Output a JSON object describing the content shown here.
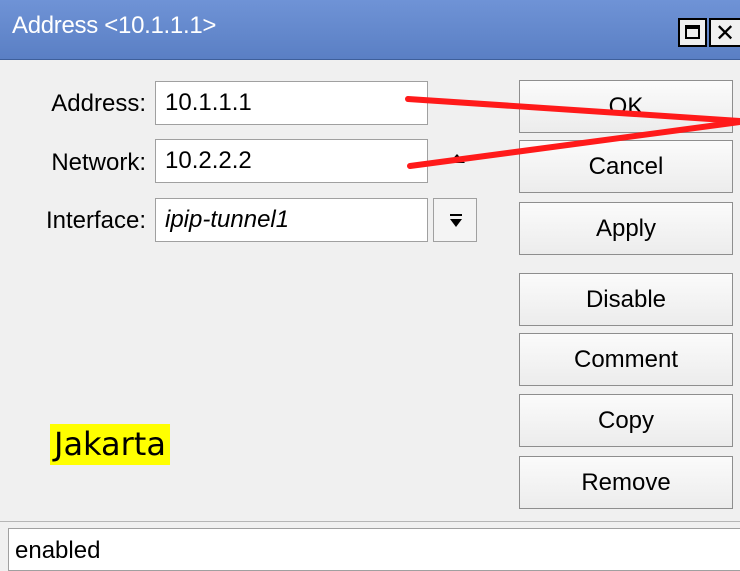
{
  "window": {
    "title": "Address <10.1.1.1>",
    "controls": [
      "maximize-icon",
      "close-icon"
    ]
  },
  "form": {
    "address": {
      "label": "Address:",
      "value": "10.1.1.1"
    },
    "network": {
      "label": "Network:",
      "value": "10.2.2.2"
    },
    "interface": {
      "label": "Interface:",
      "value": "ipip-tunnel1"
    }
  },
  "buttons": {
    "ok": "OK",
    "cancel": "Cancel",
    "apply": "Apply",
    "disable": "Disable",
    "comment": "Comment",
    "copy": "Copy",
    "remove": "Remove"
  },
  "annotation": {
    "site_label": "Jakarta",
    "highlight_color": "#ffff00",
    "arrow_color": "#ff0000"
  },
  "status": {
    "text": "enabled"
  },
  "colors": {
    "titlebar": "#6285cc",
    "window_bg": "#f0f0f0"
  }
}
